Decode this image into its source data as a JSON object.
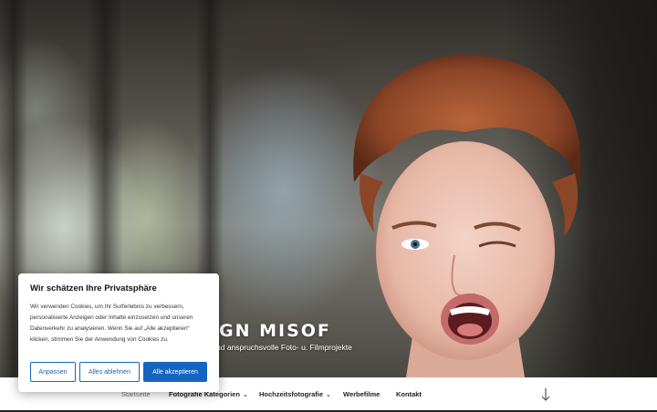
{
  "hero": {
    "site_title": "GN MISOF",
    "tagline": "nd anspruchsvolle Foto- u. Filmprojekte"
  },
  "nav": {
    "items": [
      {
        "label": "Startseite",
        "current": true,
        "has_submenu": false
      },
      {
        "label": "Fotografie Kategorien",
        "current": false,
        "has_submenu": true
      },
      {
        "label": "Hochzeitsfotografie",
        "current": false,
        "has_submenu": true
      },
      {
        "label": "Werbefilme",
        "current": false,
        "has_submenu": false
      },
      {
        "label": "Kontakt",
        "current": false,
        "has_submenu": false
      }
    ],
    "submenu_glyph": "⌄",
    "scroll_icon": "arrow-down-icon"
  },
  "cookie": {
    "title": "Wir schätzen Ihre Privatsphäre",
    "text": "Wir verwenden Cookies, um Ihr Surferlebnis zu verbessern, personalisierte Anzeigen oder Inhalte einzusetzen und unseren Datenverkehr zu analysieren. Wenn Sie auf „Alle akzeptieren“ klicken, stimmen Sie der Anwendung von Cookies zu.",
    "buttons": {
      "customize": "Anpassen",
      "reject_all": "Alles ablehnen",
      "accept_all": "Alle akzeptieren"
    }
  },
  "colors": {
    "accent": "#1565c0",
    "nav_text": "#222222",
    "nav_current": "#777777"
  }
}
